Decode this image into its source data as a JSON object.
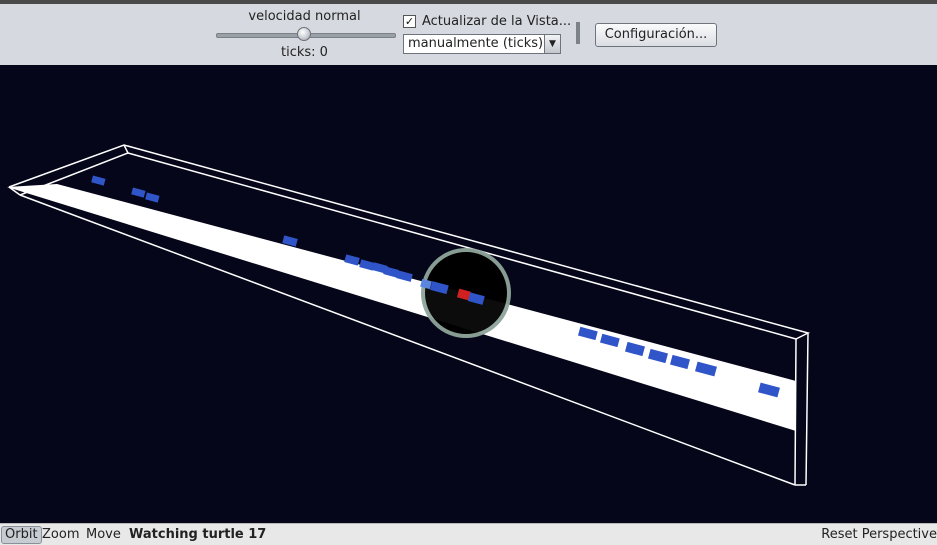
{
  "toolbar": {
    "speed_label": "velocidad normal",
    "speed_value": 0.5,
    "ticks_text": "ticks: 0",
    "update_checkbox_checked": true,
    "update_checkbox_label": "Actualizar de la Vista...",
    "update_mode_selected": "manualmente (ticks)",
    "config_button_label": "Configuración..."
  },
  "view": {
    "background_color": "#06061a",
    "road_color": "#ffffff",
    "car_color": "#2f55c8",
    "watched_car_color": "#d02020",
    "checkbox_glyph": "✓",
    "combo_arrow_glyph": "▼"
  },
  "bottom_bar": {
    "modes": [
      "Orbit",
      "Zoom",
      "Move"
    ],
    "active_mode": "Orbit",
    "status_text": "Watching turtle 17",
    "reset_label": "Reset Perspective"
  }
}
